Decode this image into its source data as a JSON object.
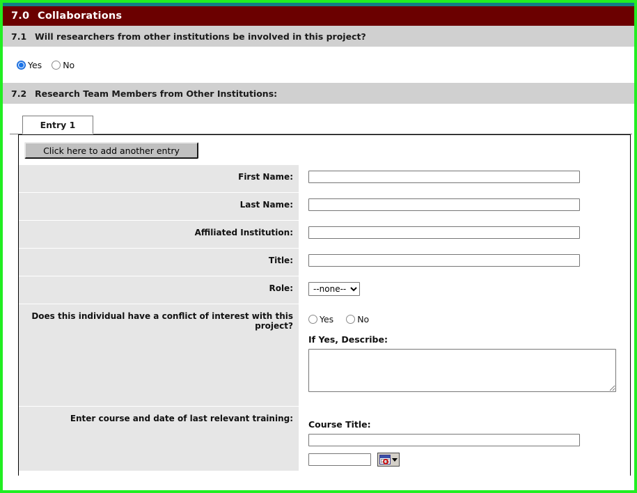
{
  "section": {
    "number": "7.0",
    "title": "Collaborations"
  },
  "questions": [
    {
      "number": "7.1",
      "text": "Will researchers from other institutions be involved in this project?",
      "options": [
        {
          "label": "Yes",
          "selected": true
        },
        {
          "label": "No",
          "selected": false
        }
      ]
    },
    {
      "number": "7.2",
      "text": "Research Team Members from Other Institutions:"
    }
  ],
  "tabs": [
    {
      "label": "Entry 1",
      "active": true
    }
  ],
  "entry_panel": {
    "add_entry_button": "Click here to add another entry",
    "fields": [
      {
        "label": "First Name:",
        "value": "",
        "type": "text"
      },
      {
        "label": "Last Name:",
        "value": "",
        "type": "text"
      },
      {
        "label": "Affiliated Institution:",
        "value": "",
        "type": "text"
      },
      {
        "label": "Title:",
        "value": "",
        "type": "text"
      },
      {
        "label": "Role:",
        "value": "--none--",
        "type": "select",
        "options": [
          "--none--"
        ]
      }
    ],
    "conflict": {
      "label": "Does this individual have a conflict of interest with this project?",
      "options": [
        {
          "label": "Yes",
          "selected": false
        },
        {
          "label": "No",
          "selected": false
        }
      ],
      "describe_label": "If Yes, Describe:",
      "describe_value": ""
    },
    "training": {
      "label": "Enter course and date of last relevant training:",
      "course_title_label": "Course Title:",
      "course_title_value": "",
      "date_value": "",
      "date_picker_icon": "calendar-icon"
    }
  },
  "colors": {
    "page_border": "#22ee22",
    "top_strip": "#127e84",
    "section_header_bg": "#6b0000",
    "question_bar_bg": "#d0d0d0",
    "row_label_bg": "#e6e6e6",
    "radio_accent": "#1a73e8"
  }
}
